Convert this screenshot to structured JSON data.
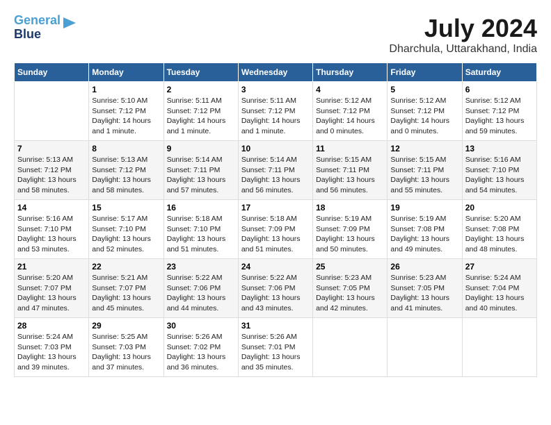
{
  "header": {
    "logo_line1": "General",
    "logo_line2": "Blue",
    "month": "July 2024",
    "location": "Dharchula, Uttarakhand, India"
  },
  "columns": [
    "Sunday",
    "Monday",
    "Tuesday",
    "Wednesday",
    "Thursday",
    "Friday",
    "Saturday"
  ],
  "weeks": [
    [
      {
        "day": "",
        "info": ""
      },
      {
        "day": "1",
        "info": "Sunrise: 5:10 AM\nSunset: 7:12 PM\nDaylight: 14 hours\nand 1 minute."
      },
      {
        "day": "2",
        "info": "Sunrise: 5:11 AM\nSunset: 7:12 PM\nDaylight: 14 hours\nand 1 minute."
      },
      {
        "day": "3",
        "info": "Sunrise: 5:11 AM\nSunset: 7:12 PM\nDaylight: 14 hours\nand 1 minute."
      },
      {
        "day": "4",
        "info": "Sunrise: 5:12 AM\nSunset: 7:12 PM\nDaylight: 14 hours\nand 0 minutes."
      },
      {
        "day": "5",
        "info": "Sunrise: 5:12 AM\nSunset: 7:12 PM\nDaylight: 14 hours\nand 0 minutes."
      },
      {
        "day": "6",
        "info": "Sunrise: 5:12 AM\nSunset: 7:12 PM\nDaylight: 13 hours\nand 59 minutes."
      }
    ],
    [
      {
        "day": "7",
        "info": "Sunrise: 5:13 AM\nSunset: 7:12 PM\nDaylight: 13 hours\nand 58 minutes."
      },
      {
        "day": "8",
        "info": "Sunrise: 5:13 AM\nSunset: 7:12 PM\nDaylight: 13 hours\nand 58 minutes."
      },
      {
        "day": "9",
        "info": "Sunrise: 5:14 AM\nSunset: 7:11 PM\nDaylight: 13 hours\nand 57 minutes."
      },
      {
        "day": "10",
        "info": "Sunrise: 5:14 AM\nSunset: 7:11 PM\nDaylight: 13 hours\nand 56 minutes."
      },
      {
        "day": "11",
        "info": "Sunrise: 5:15 AM\nSunset: 7:11 PM\nDaylight: 13 hours\nand 56 minutes."
      },
      {
        "day": "12",
        "info": "Sunrise: 5:15 AM\nSunset: 7:11 PM\nDaylight: 13 hours\nand 55 minutes."
      },
      {
        "day": "13",
        "info": "Sunrise: 5:16 AM\nSunset: 7:10 PM\nDaylight: 13 hours\nand 54 minutes."
      }
    ],
    [
      {
        "day": "14",
        "info": "Sunrise: 5:16 AM\nSunset: 7:10 PM\nDaylight: 13 hours\nand 53 minutes."
      },
      {
        "day": "15",
        "info": "Sunrise: 5:17 AM\nSunset: 7:10 PM\nDaylight: 13 hours\nand 52 minutes."
      },
      {
        "day": "16",
        "info": "Sunrise: 5:18 AM\nSunset: 7:10 PM\nDaylight: 13 hours\nand 51 minutes."
      },
      {
        "day": "17",
        "info": "Sunrise: 5:18 AM\nSunset: 7:09 PM\nDaylight: 13 hours\nand 51 minutes."
      },
      {
        "day": "18",
        "info": "Sunrise: 5:19 AM\nSunset: 7:09 PM\nDaylight: 13 hours\nand 50 minutes."
      },
      {
        "day": "19",
        "info": "Sunrise: 5:19 AM\nSunset: 7:08 PM\nDaylight: 13 hours\nand 49 minutes."
      },
      {
        "day": "20",
        "info": "Sunrise: 5:20 AM\nSunset: 7:08 PM\nDaylight: 13 hours\nand 48 minutes."
      }
    ],
    [
      {
        "day": "21",
        "info": "Sunrise: 5:20 AM\nSunset: 7:07 PM\nDaylight: 13 hours\nand 47 minutes."
      },
      {
        "day": "22",
        "info": "Sunrise: 5:21 AM\nSunset: 7:07 PM\nDaylight: 13 hours\nand 45 minutes."
      },
      {
        "day": "23",
        "info": "Sunrise: 5:22 AM\nSunset: 7:06 PM\nDaylight: 13 hours\nand 44 minutes."
      },
      {
        "day": "24",
        "info": "Sunrise: 5:22 AM\nSunset: 7:06 PM\nDaylight: 13 hours\nand 43 minutes."
      },
      {
        "day": "25",
        "info": "Sunrise: 5:23 AM\nSunset: 7:05 PM\nDaylight: 13 hours\nand 42 minutes."
      },
      {
        "day": "26",
        "info": "Sunrise: 5:23 AM\nSunset: 7:05 PM\nDaylight: 13 hours\nand 41 minutes."
      },
      {
        "day": "27",
        "info": "Sunrise: 5:24 AM\nSunset: 7:04 PM\nDaylight: 13 hours\nand 40 minutes."
      }
    ],
    [
      {
        "day": "28",
        "info": "Sunrise: 5:24 AM\nSunset: 7:03 PM\nDaylight: 13 hours\nand 39 minutes."
      },
      {
        "day": "29",
        "info": "Sunrise: 5:25 AM\nSunset: 7:03 PM\nDaylight: 13 hours\nand 37 minutes."
      },
      {
        "day": "30",
        "info": "Sunrise: 5:26 AM\nSunset: 7:02 PM\nDaylight: 13 hours\nand 36 minutes."
      },
      {
        "day": "31",
        "info": "Sunrise: 5:26 AM\nSunset: 7:01 PM\nDaylight: 13 hours\nand 35 minutes."
      },
      {
        "day": "",
        "info": ""
      },
      {
        "day": "",
        "info": ""
      },
      {
        "day": "",
        "info": ""
      }
    ]
  ]
}
